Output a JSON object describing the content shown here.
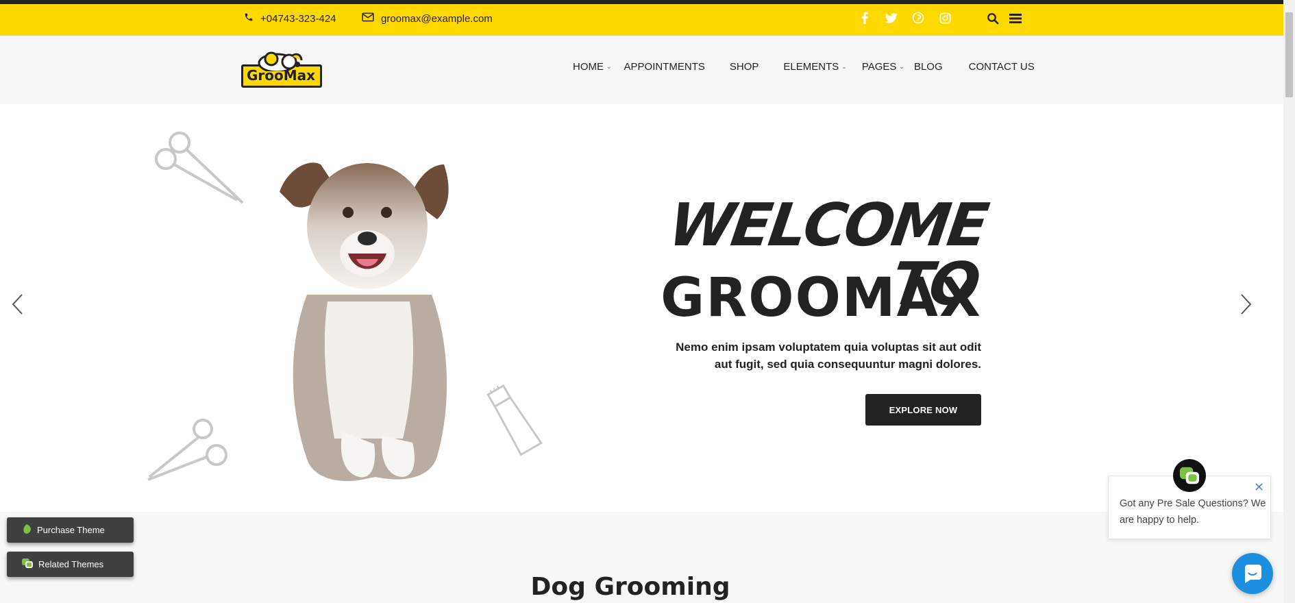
{
  "topbar": {
    "phone": "+04743-323-424",
    "email": "groomax@example.com",
    "social_icons": [
      "facebook-icon",
      "twitter-icon",
      "pinterest-icon",
      "instagram-icon"
    ],
    "background_color": "#ffd800"
  },
  "header": {
    "logo_text": "GrooMax",
    "nav": [
      {
        "label": "HOME",
        "has_dropdown": true
      },
      {
        "label": "APPOINTMENTS",
        "has_dropdown": false
      },
      {
        "label": "SHOP",
        "has_dropdown": false
      },
      {
        "label": "ELEMENTS",
        "has_dropdown": true
      },
      {
        "label": "PAGES",
        "has_dropdown": true
      },
      {
        "label": "BLOG",
        "has_dropdown": false
      },
      {
        "label": "CONTACT US",
        "has_dropdown": false
      }
    ]
  },
  "hero": {
    "welcome": "WELCOME TO",
    "brand": "GROOMAX",
    "subtitle": "Nemo enim ipsam voluptatem quia voluptas sit aut odit aut fugit, sed quia consequuntur magni dolores.",
    "button_label": "EXPLORE NOW"
  },
  "section": {
    "title": "Dog Grooming"
  },
  "floating": {
    "purchase_label": "Purchase Theme",
    "related_label": "Related Themes"
  },
  "chat": {
    "message": "Got any Pre Sale Questions? We are happy to help.",
    "accent_color": "#1d8fe1"
  }
}
